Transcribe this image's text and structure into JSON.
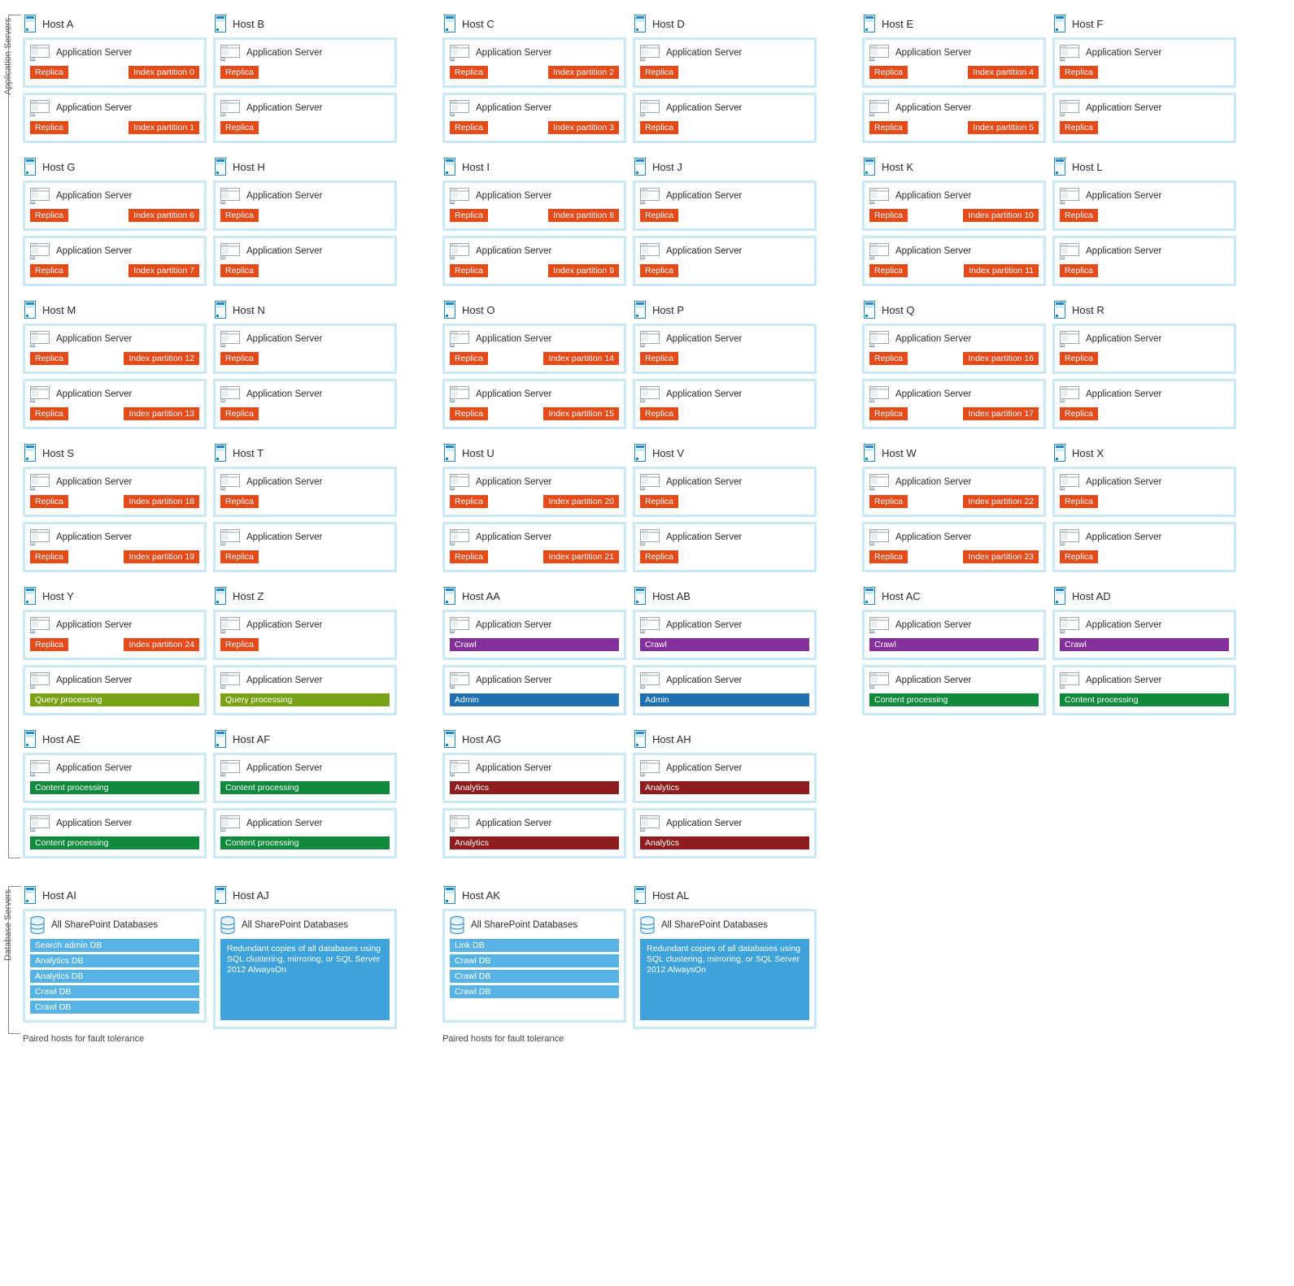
{
  "labels": {
    "appServers": "Application Servers",
    "dbServers": "Database Servers",
    "appServer": "Application Server",
    "allDb": "All SharePoint Databases",
    "replica": "Replica",
    "indexPartition": "Index partition",
    "query": "Query processing",
    "crawl": "Crawl",
    "admin": "Admin",
    "content": "Content processing",
    "analytics": "Analytics",
    "pairedNote": "Paired hosts for fault tolerance",
    "redundant": "Redundant copies of all databases using SQL clustering, mirroring, or SQL Server 2012 AlwaysOn"
  },
  "dbLists": {
    "ai": [
      "Search admin DB",
      "Analytics DB",
      "Analytics DB",
      "Crawl DB",
      "Crawl DB"
    ],
    "ak": [
      "Link DB",
      "Crawl DB",
      "Crawl DB",
      "Crawl DB"
    ]
  },
  "colors": {
    "replica": "c-orange",
    "query": "c-olive",
    "crawl": "c-purple",
    "admin": "c-blue",
    "content": "c-green",
    "analytics": "c-darkred"
  },
  "appRows": [
    [
      {
        "type": "ixpair",
        "left": "Host A",
        "right": "Host B",
        "ix": [
          0,
          1
        ]
      },
      {
        "type": "ixpair",
        "left": "Host C",
        "right": "Host D",
        "ix": [
          2,
          3
        ]
      },
      {
        "type": "ixpair",
        "left": "Host E",
        "right": "Host F",
        "ix": [
          4,
          5
        ]
      }
    ],
    [
      {
        "type": "ixpair",
        "left": "Host G",
        "right": "Host H",
        "ix": [
          6,
          7
        ]
      },
      {
        "type": "ixpair",
        "left": "Host I",
        "right": "Host J",
        "ix": [
          8,
          9
        ]
      },
      {
        "type": "ixpair",
        "left": "Host K",
        "right": "Host L",
        "ix": [
          10,
          11
        ]
      }
    ],
    [
      {
        "type": "ixpair",
        "left": "Host M",
        "right": "Host N",
        "ix": [
          12,
          13
        ]
      },
      {
        "type": "ixpair",
        "left": "Host O",
        "right": "Host P",
        "ix": [
          14,
          15
        ]
      },
      {
        "type": "ixpair",
        "left": "Host Q",
        "right": "Host R",
        "ix": [
          16,
          17
        ]
      }
    ],
    [
      {
        "type": "ixpair",
        "left": "Host S",
        "right": "Host T",
        "ix": [
          18,
          19
        ]
      },
      {
        "type": "ixpair",
        "left": "Host U",
        "right": "Host V",
        "ix": [
          20,
          21
        ]
      },
      {
        "type": "ixpair",
        "left": "Host W",
        "right": "Host X",
        "ix": [
          22,
          23
        ]
      }
    ],
    [
      {
        "type": "ixmix",
        "left": "Host Y",
        "right": "Host Z",
        "ix": [
          24
        ],
        "second": "query"
      },
      {
        "type": "rolepair",
        "left": "Host AA",
        "right": "Host AB",
        "roles": [
          "crawl",
          "admin"
        ]
      },
      {
        "type": "rolepair",
        "left": "Host AC",
        "right": "Host AD",
        "roles": [
          "crawl",
          "content"
        ]
      }
    ],
    [
      {
        "type": "rolepair",
        "left": "Host AE",
        "right": "Host AF",
        "roles": [
          "content",
          "content"
        ]
      },
      {
        "type": "rolepair",
        "left": "Host AG",
        "right": "Host AH",
        "roles": [
          "analytics",
          "analytics"
        ]
      }
    ]
  ],
  "dbRow": [
    {
      "left": "Host AI",
      "right": "Host AJ",
      "leftList": "ai"
    },
    {
      "left": "Host AK",
      "right": "Host AL",
      "leftList": "ak"
    }
  ]
}
